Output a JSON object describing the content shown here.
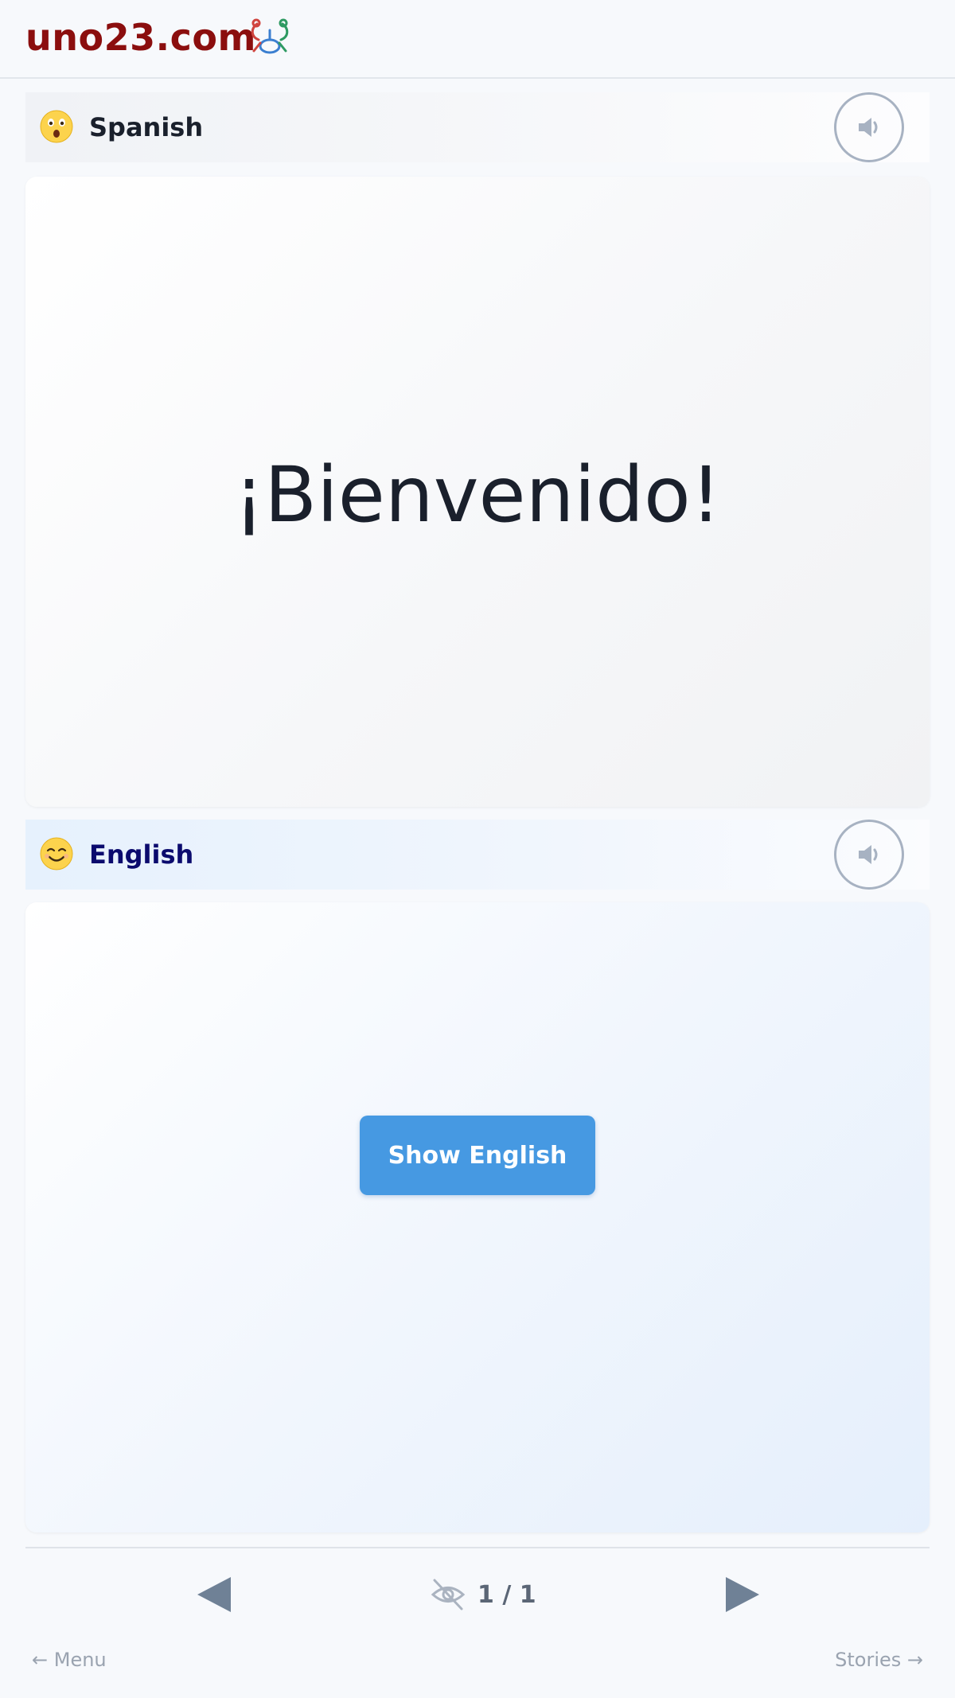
{
  "header": {
    "site_name": "uno23.com",
    "logo_icon": "juggling-figure-icon",
    "brand_color": "#8b0e0e"
  },
  "source": {
    "language_label": "Spanish",
    "emoji": "astonished-face-emoji",
    "phrase": "¡Bienvenido!",
    "speaker_icon": "speaker-icon"
  },
  "target": {
    "language_label": "English",
    "emoji": "smiling-face-emoji",
    "reveal_button_label": "Show English",
    "speaker_icon": "speaker-icon",
    "accent_color": "#4699e2"
  },
  "pager": {
    "prev_icon": "triangle-left-icon",
    "next_icon": "triangle-right-icon",
    "visibility_icon": "eye-slash-icon",
    "counter": "1 / 1"
  },
  "footer": {
    "menu_label": "← Menu",
    "stories_label": "Stories →"
  }
}
